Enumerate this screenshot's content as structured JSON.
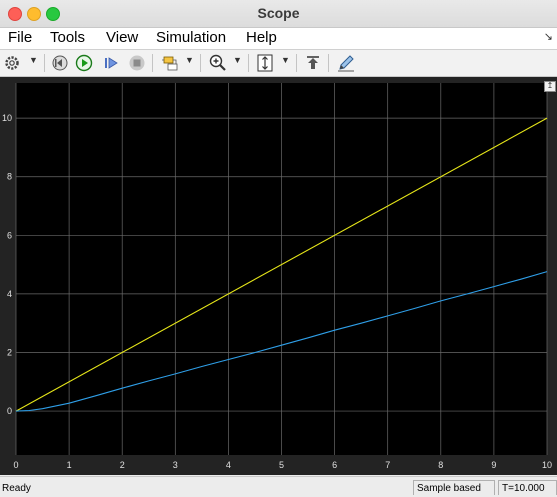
{
  "window": {
    "title": "Scope"
  },
  "menu": [
    "File",
    "Tools",
    "View",
    "Simulation",
    "Help"
  ],
  "toolbar": {
    "icons": [
      "settings-icon",
      "step-back-icon",
      "run-icon",
      "step-forward-icon",
      "stop-icon",
      "highlight-block-icon",
      "zoom-in-icon",
      "scale-axes-icon",
      "restore-icon",
      "edit-icon"
    ]
  },
  "status": {
    "ready": "Ready",
    "mode": "Sample based",
    "time": "T=10.000"
  },
  "colors": {
    "background": "#000000",
    "grid": "#6a6a6a",
    "series1": "#e6e619",
    "series2": "#2f9fe8"
  },
  "chart_data": {
    "type": "line",
    "xlim": [
      0,
      10
    ],
    "ylim": [
      -1.5,
      11.2
    ],
    "xticks": [
      "0",
      "1",
      "2",
      "3",
      "4",
      "5",
      "6",
      "7",
      "8",
      "9",
      "10"
    ],
    "yticks": [
      "0",
      "2",
      "4",
      "6",
      "8",
      "10"
    ],
    "grid": true,
    "series": [
      {
        "x": [
          0,
          10
        ],
        "y": [
          0,
          10
        ],
        "color": "#e6e619"
      },
      {
        "x": [
          0,
          0.25,
          0.5,
          1,
          1.5,
          2,
          2.5,
          3,
          3.5,
          4,
          4.5,
          5,
          5.5,
          6,
          6.5,
          7,
          7.5,
          8,
          8.5,
          9,
          9.5,
          10
        ],
        "y": [
          0,
          0.02,
          0.08,
          0.27,
          0.52,
          0.78,
          1.03,
          1.27,
          1.52,
          1.76,
          2.0,
          2.25,
          2.5,
          2.76,
          3.0,
          3.25,
          3.5,
          3.76,
          4.0,
          4.25,
          4.5,
          4.76
        ],
        "color": "#2f9fe8"
      }
    ]
  }
}
